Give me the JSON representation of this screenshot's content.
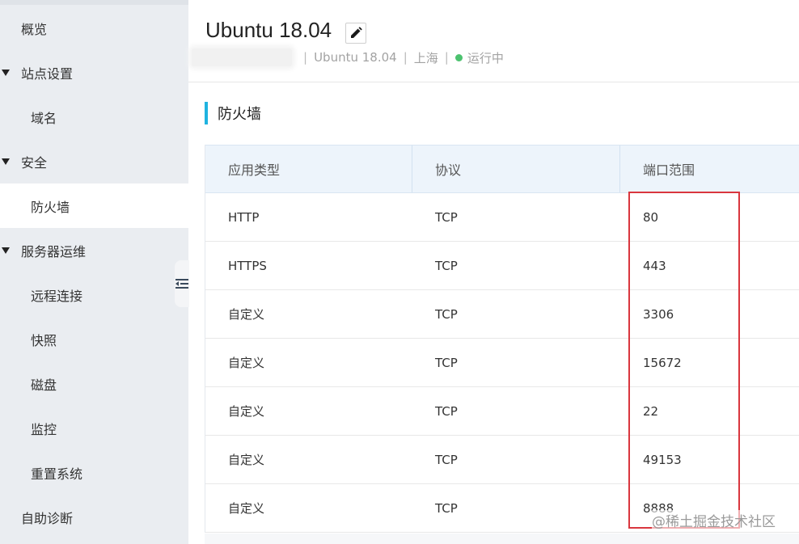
{
  "sidebar": {
    "items": [
      {
        "label": "概览",
        "level": "top",
        "active": false,
        "caret": false
      },
      {
        "label": "站点设置",
        "level": "top",
        "active": false,
        "caret": true
      },
      {
        "label": "域名",
        "level": "sub",
        "active": false,
        "caret": false
      },
      {
        "label": "安全",
        "level": "top",
        "active": false,
        "caret": true
      },
      {
        "label": "防火墙",
        "level": "sub",
        "active": true,
        "caret": false
      },
      {
        "label": "服务器运维",
        "level": "top",
        "active": false,
        "caret": true
      },
      {
        "label": "远程连接",
        "level": "sub",
        "active": false,
        "caret": false
      },
      {
        "label": "快照",
        "level": "sub",
        "active": false,
        "caret": false
      },
      {
        "label": "磁盘",
        "level": "sub",
        "active": false,
        "caret": false
      },
      {
        "label": "监控",
        "level": "sub",
        "active": false,
        "caret": false
      },
      {
        "label": "重置系统",
        "level": "sub",
        "active": false,
        "caret": false
      },
      {
        "label": "自助诊断",
        "level": "top",
        "active": false,
        "caret": false
      }
    ],
    "collapse_icon": "outdent-icon"
  },
  "header": {
    "title": "Ubuntu 18.04",
    "edit_icon": "pencil-icon",
    "meta": {
      "os": "Ubuntu 18.04",
      "region": "上海",
      "status": "运行中",
      "status_color": "#4cc26f",
      "separator": "|"
    }
  },
  "section": {
    "title": "防火墙",
    "accent_color": "#1fb3e0"
  },
  "table": {
    "columns": [
      "应用类型",
      "协议",
      "端口范围"
    ],
    "rows": [
      [
        "HTTP",
        "TCP",
        "80"
      ],
      [
        "HTTPS",
        "TCP",
        "443"
      ],
      [
        "自定义",
        "TCP",
        "3306"
      ],
      [
        "自定义",
        "TCP",
        "15672"
      ],
      [
        "自定义",
        "TCP",
        "22"
      ],
      [
        "自定义",
        "TCP",
        "49153"
      ],
      [
        "自定义",
        "TCP",
        "8888"
      ]
    ]
  },
  "highlight_color": "#d9363e",
  "watermark": "@稀土掘金技术社区"
}
